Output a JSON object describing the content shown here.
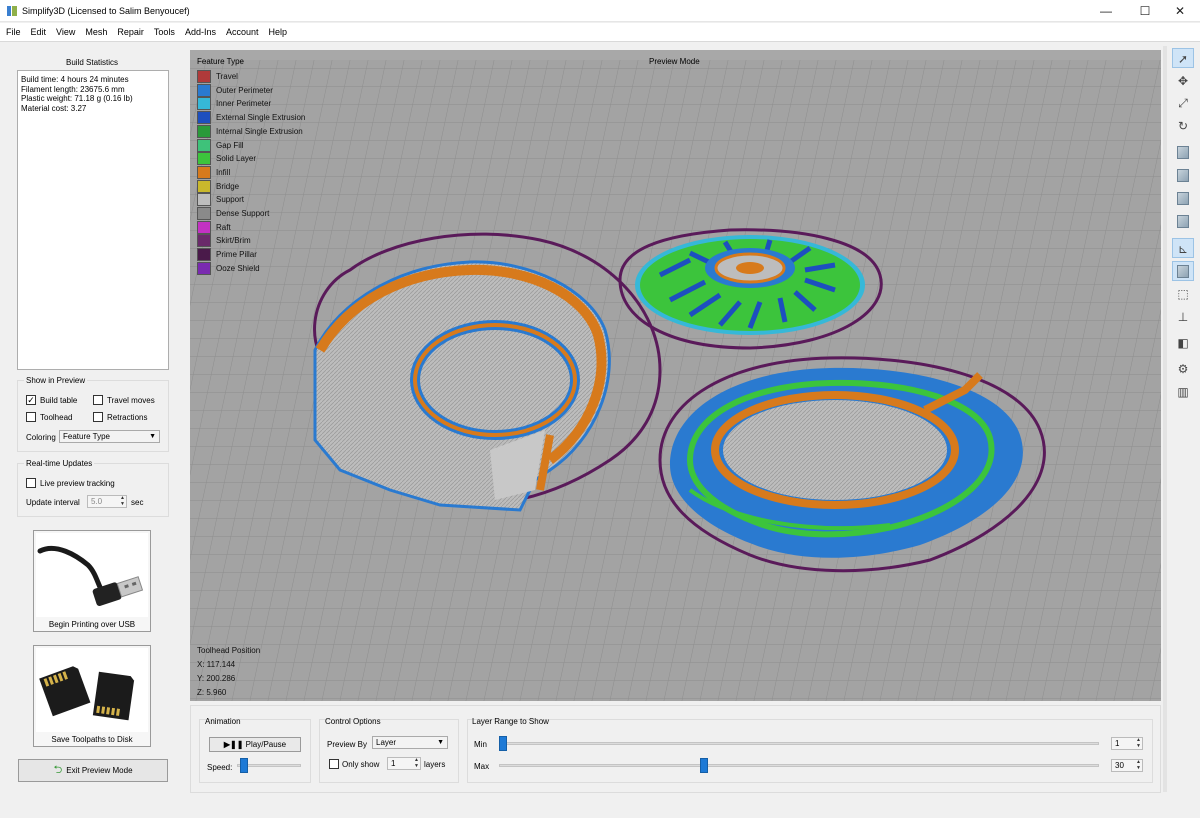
{
  "window": {
    "title": "Simplify3D (Licensed to Salim Benyoucef)",
    "minimize": "—",
    "maximize": "☐",
    "close": "✕"
  },
  "menu": [
    "File",
    "Edit",
    "View",
    "Mesh",
    "Repair",
    "Tools",
    "Add-Ins",
    "Account",
    "Help"
  ],
  "build_statistics": {
    "title": "Build Statistics",
    "lines": [
      "Build time: 4 hours 24 minutes",
      "Filament length: 23675.6 mm",
      "Plastic weight: 71.18 g (0.16 lb)",
      "Material cost: 3.27"
    ]
  },
  "show_in_preview": {
    "title": "Show in Preview",
    "build_table": {
      "label": "Build table",
      "checked": true
    },
    "travel_moves": {
      "label": "Travel moves",
      "checked": false
    },
    "toolhead": {
      "label": "Toolhead",
      "checked": false
    },
    "retractions": {
      "label": "Retractions",
      "checked": false
    },
    "coloring_label": "Coloring",
    "coloring_value": "Feature Type"
  },
  "realtime": {
    "title": "Real-time Updates",
    "live_tracking": {
      "label": "Live preview tracking",
      "checked": false
    },
    "interval_label": "Update interval",
    "interval_value": "5.0",
    "interval_unit": "sec"
  },
  "buttons": {
    "usb": "Begin Printing over USB",
    "disk": "Save Toolpaths to Disk",
    "exit": "Exit Preview Mode",
    "play": "Play/Pause"
  },
  "viewport": {
    "mode_label": "Preview Mode",
    "legend_title": "Feature Type",
    "legend": [
      {
        "label": "Travel",
        "color": "#b03a3a"
      },
      {
        "label": "Outer Perimeter",
        "color": "#2a7ad0"
      },
      {
        "label": "Inner Perimeter",
        "color": "#36b8d8"
      },
      {
        "label": "External Single Extrusion",
        "color": "#1d4fbf"
      },
      {
        "label": "Internal Single Extrusion",
        "color": "#2a9a3a"
      },
      {
        "label": "Gap Fill",
        "color": "#3ec27a"
      },
      {
        "label": "Solid Layer",
        "color": "#3cc43c"
      },
      {
        "label": "Infill",
        "color": "#d77a1c"
      },
      {
        "label": "Bridge",
        "color": "#c9b82c"
      },
      {
        "label": "Support",
        "color": "#bdbdbd"
      },
      {
        "label": "Dense Support",
        "color": "#8a8a8a"
      },
      {
        "label": "Raft",
        "color": "#c332c3"
      },
      {
        "label": "Skirt/Brim",
        "color": "#6a2a6a"
      },
      {
        "label": "Prime Pillar",
        "color": "#4a1a4a"
      },
      {
        "label": "Ooze Shield",
        "color": "#7a2ab0"
      }
    ],
    "toolhead_title": "Toolhead Position",
    "toolhead_x": "X: 117.144",
    "toolhead_y": "Y: 200.286",
    "toolhead_z": "Z: 5.960"
  },
  "animation": {
    "title": "Animation",
    "speed_label": "Speed:",
    "speed": 0.05
  },
  "control_options": {
    "title": "Control Options",
    "preview_by_label": "Preview By",
    "preview_by_value": "Layer",
    "only_show_label": "Only show",
    "only_show_value": "1",
    "layers_label": "layers"
  },
  "layer_range": {
    "title": "Layer Range to Show",
    "min_label": "Min",
    "max_label": "Max",
    "min_value": "1",
    "max_value": "30",
    "min_fraction": 0.0,
    "max_fraction": 0.34
  }
}
